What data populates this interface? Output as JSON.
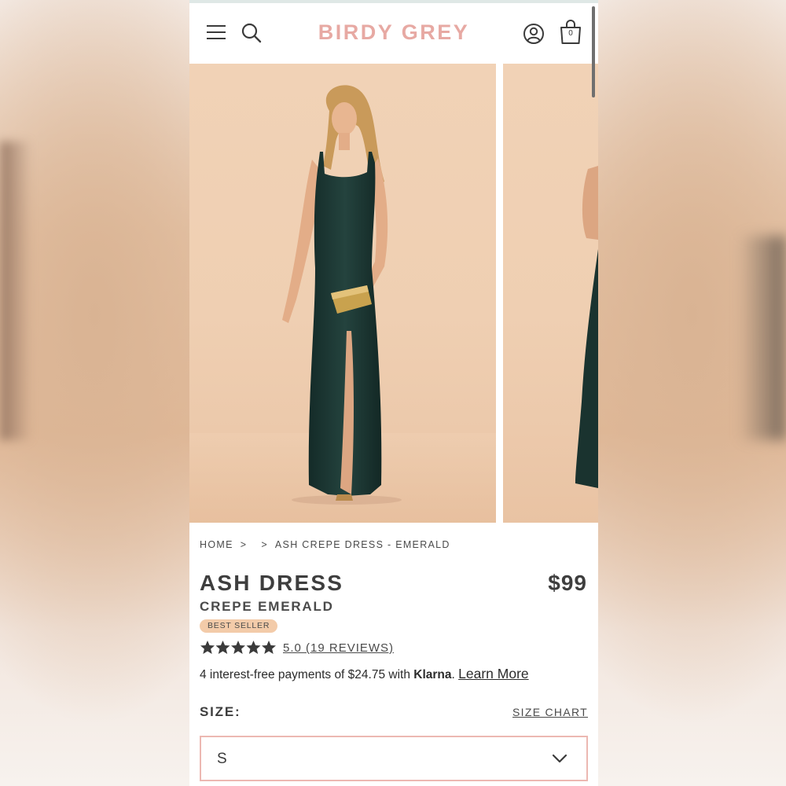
{
  "header": {
    "logo": "BIRDY GREY",
    "cart_count": "0"
  },
  "breadcrumb": {
    "home": "HOME",
    "current": "ASH CREPE DRESS - EMERALD"
  },
  "product": {
    "title": "ASH DRESS",
    "subtitle": "CREPE EMERALD",
    "price": "$99",
    "badge": "BEST SELLER",
    "rating": 5.0,
    "rating_text": "5.0 (19 REVIEWS)",
    "dress_color": "#1f3a36"
  },
  "klarna": {
    "text": "4 interest-free payments of $24.75 with ",
    "brand": "Klarna",
    "period": ".",
    "link": "Learn More"
  },
  "size": {
    "label": "SIZE:",
    "chart_link": "SIZE CHART",
    "selected": "S"
  },
  "colors": {
    "brand_pink": "#e7a9a3",
    "badge_peach": "#f3cba9",
    "text_dark": "#3e3e3e"
  }
}
